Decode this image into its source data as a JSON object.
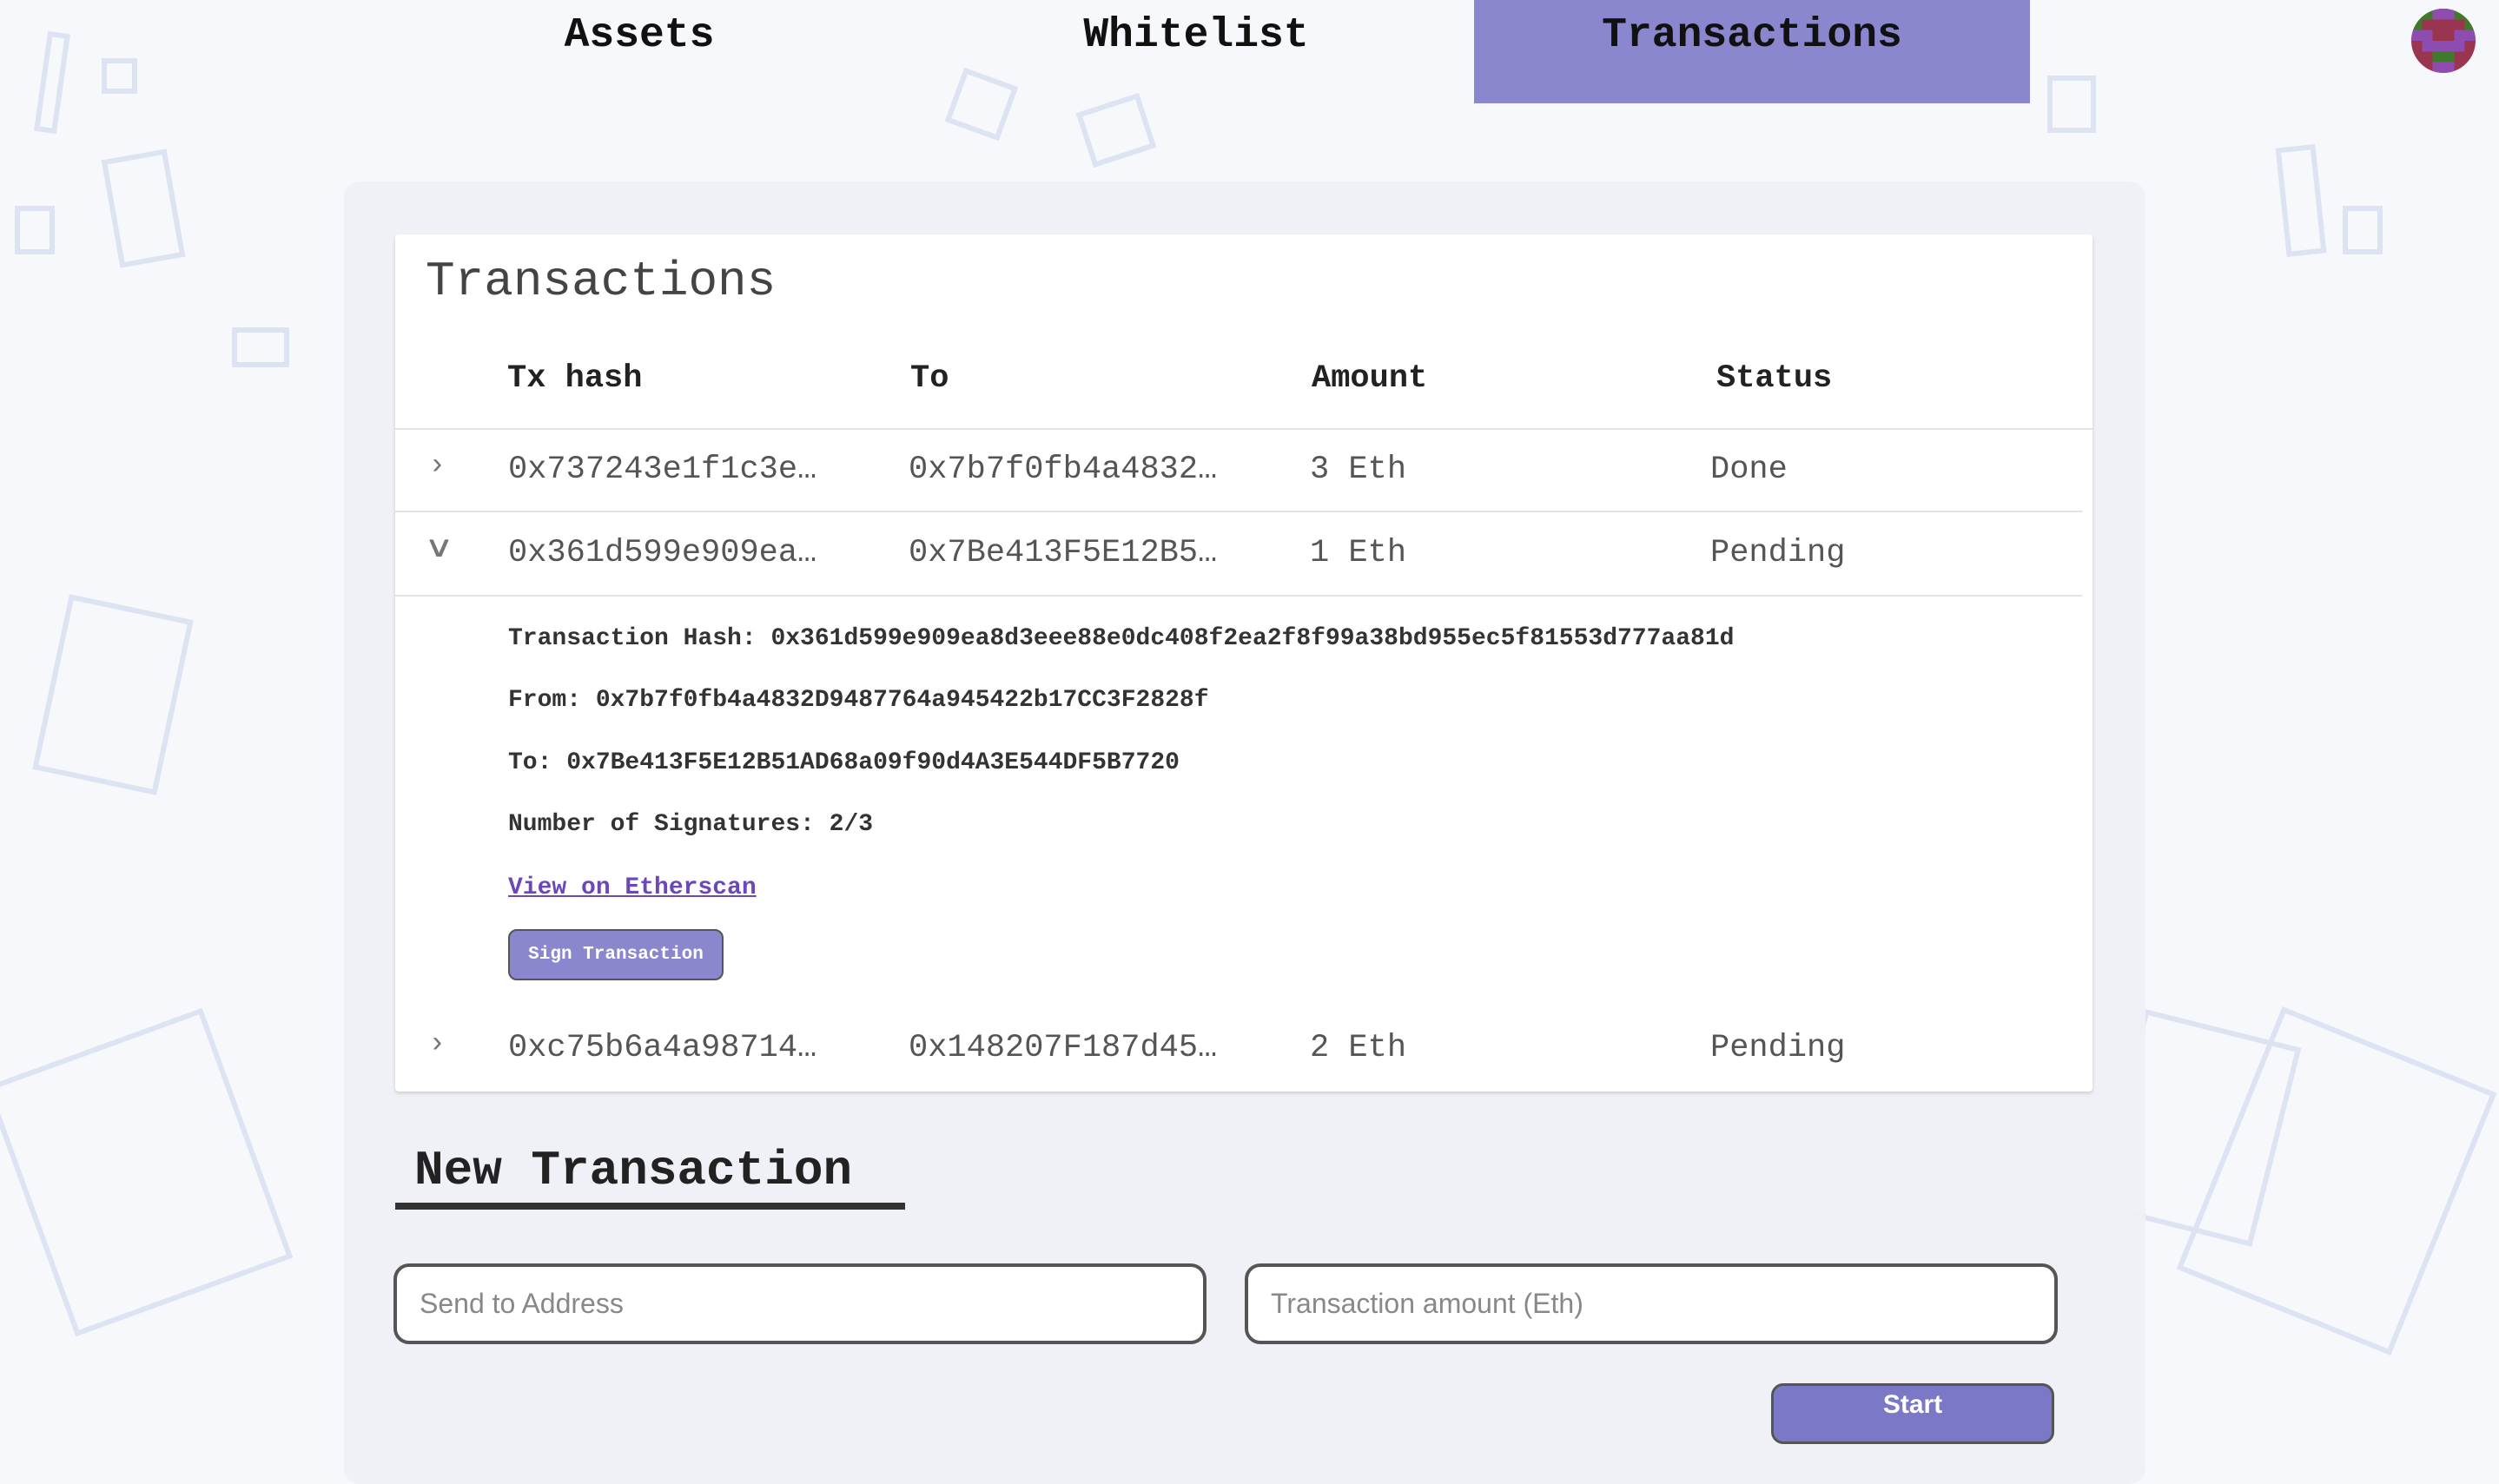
{
  "nav": {
    "tabs": [
      {
        "label": "Assets",
        "active": false
      },
      {
        "label": "Whitelist",
        "active": false
      },
      {
        "label": "Transactions",
        "active": true
      }
    ],
    "accent": "#8b87cf"
  },
  "transactions": {
    "title": "Transactions",
    "headers": [
      "Tx hash",
      "To",
      "Amount",
      "Status"
    ],
    "rows": [
      {
        "hash": "0x737243e1f1c3e…",
        "to": "0x7b7f0fb4a4832…",
        "amount": "3 Eth",
        "status": "Done",
        "expanded": false
      },
      {
        "hash": "0x361d599e909ea…",
        "to": "0x7Be413F5E12B5…",
        "amount": "1 Eth",
        "status": "Pending",
        "expanded": true
      },
      {
        "hash": "0xc75b6a4a98714…",
        "to": "0x148207F187d45…",
        "amount": "2 Eth",
        "status": "Pending",
        "expanded": false
      }
    ],
    "details": {
      "hash": "Transaction Hash: 0x361d599e909ea8d3eee88e0dc408f2ea2f8f99a38bd955ec5f81553d777aa81d",
      "from": "From: 0x7b7f0fb4a4832D9487764a945422b17CC3F2828f",
      "to": "To: 0x7Be413F5E12B51AD68a09f90d4A3E544DF5B7720",
      "signatures": "Number of Signatures: 2/3",
      "etherscan_link": "View on Etherscan",
      "sign_button": "Sign Transaction"
    }
  },
  "new_transaction": {
    "title": "New Transaction",
    "address_placeholder": "Send to Address",
    "amount_placeholder": "Transaction amount (Eth)",
    "start_button": "Start"
  }
}
